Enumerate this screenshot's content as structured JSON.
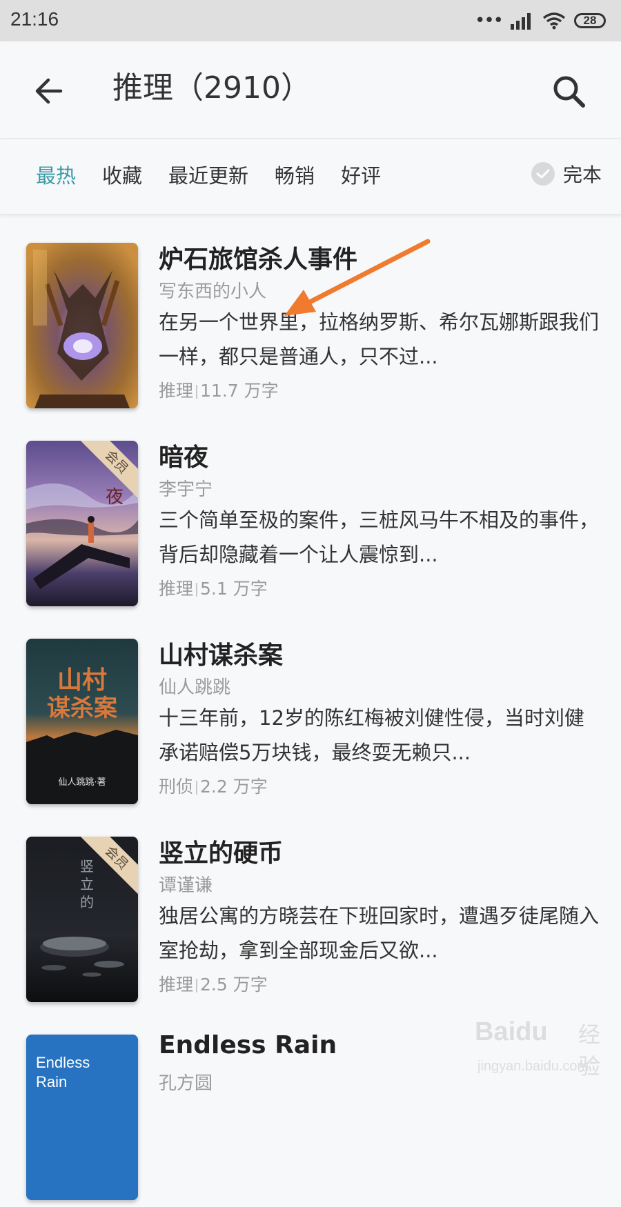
{
  "status_bar": {
    "time": "21:16",
    "dots": "•••",
    "battery": "28"
  },
  "header": {
    "title": "推理（2910）"
  },
  "filters": {
    "tabs": [
      {
        "label": "最热",
        "active": true
      },
      {
        "label": "收藏",
        "active": false
      },
      {
        "label": "最近更新",
        "active": false
      },
      {
        "label": "畅销",
        "active": false
      },
      {
        "label": "好评",
        "active": false
      }
    ],
    "complete_label": "完本"
  },
  "books": [
    {
      "title": "炉石旅馆杀人事件",
      "author": "写东西的小人",
      "description": "在另一个世界里，拉格纳罗斯、希尔瓦娜斯跟我们一样，都只是普通人，只不过...",
      "category": "推理",
      "words": "11.7 万字",
      "member": false
    },
    {
      "title": "暗夜",
      "author": "李宇宁",
      "description": "三个简单至极的案件，三桩风马牛不相及的事件，背后却隐藏着一个让人震惊到...",
      "category": "推理",
      "words": "5.1 万字",
      "member": true,
      "badge": "会员"
    },
    {
      "title": "山村谋杀案",
      "author": "仙人跳跳",
      "description": "十三年前，12岁的陈红梅被刘健性侵，当时刘健承诺赔偿5万块钱，最终耍无赖只...",
      "category": "刑侦",
      "words": "2.2 万字",
      "member": false,
      "cover_title": "山村\n谋杀案",
      "cover_author": "仙人跳跳·著"
    },
    {
      "title": "竖立的硬币",
      "author": "谭谨谦",
      "description": "独居公寓的方晓芸在下班回家时，遭遇歹徒尾随入室抢劫，拿到全部现金后又欲...",
      "category": "推理",
      "words": "2.5 万字",
      "member": true,
      "badge": "会员"
    },
    {
      "title": "Endless Rain",
      "author": "孔方圆",
      "cover_title": "Endless Rain"
    }
  ],
  "watermark": {
    "brand": "Baidu",
    "brand_cn": "经验",
    "url": "jingyan.baidu.com"
  },
  "colors": {
    "accent": "#3a9aa6",
    "arrow": "#f07a2d",
    "ribbon": "#e7d2b4"
  }
}
